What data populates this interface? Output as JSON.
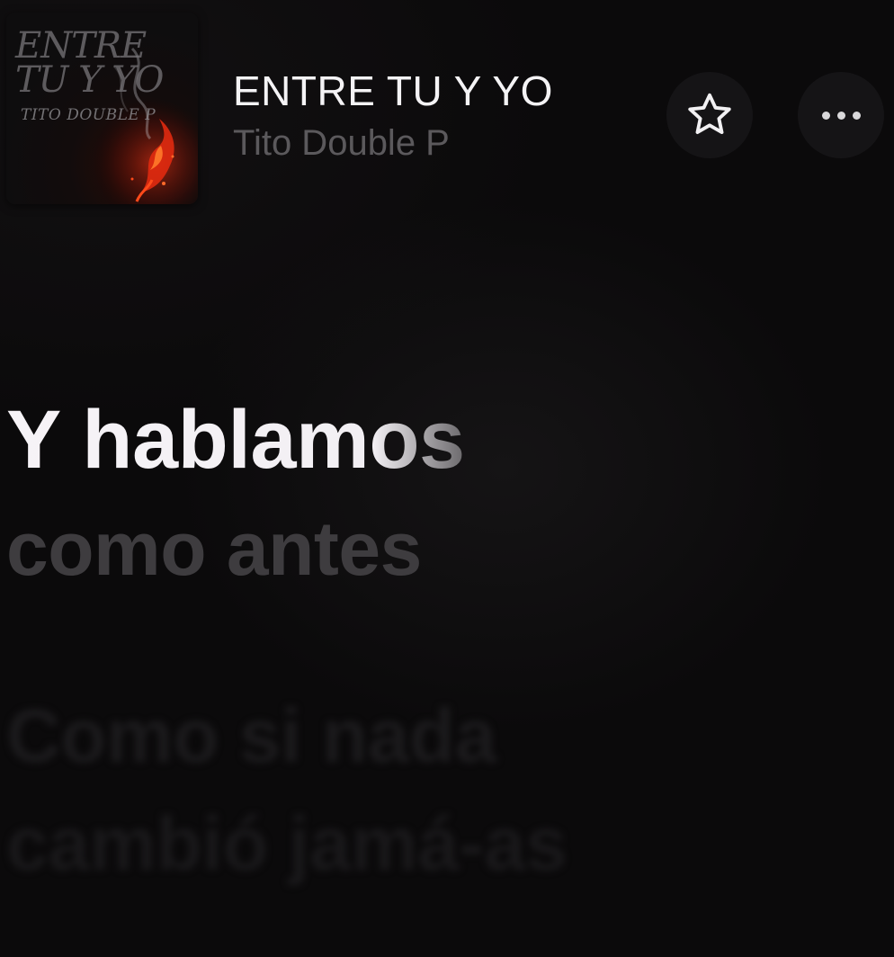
{
  "now_playing": {
    "artwork": {
      "title_text": "ENTRE TU Y YO",
      "artist_text": "TITO DOUBLE P"
    },
    "title": "ENTRE TU Y YO",
    "artist": "Tito Double P",
    "favorite_icon": "star-outline-icon",
    "more_icon": "ellipsis-icon"
  },
  "lyrics": {
    "previous_line": "",
    "current_line_1": "Y hablamos",
    "current_line_2": "como antes",
    "next_line_1": "Como si nada",
    "next_line_2": "cambió jamá-as"
  },
  "colors": {
    "background": "#0b0a0b",
    "active_lyric": "#f4f1f5",
    "secondary_text": "#5b595c"
  }
}
